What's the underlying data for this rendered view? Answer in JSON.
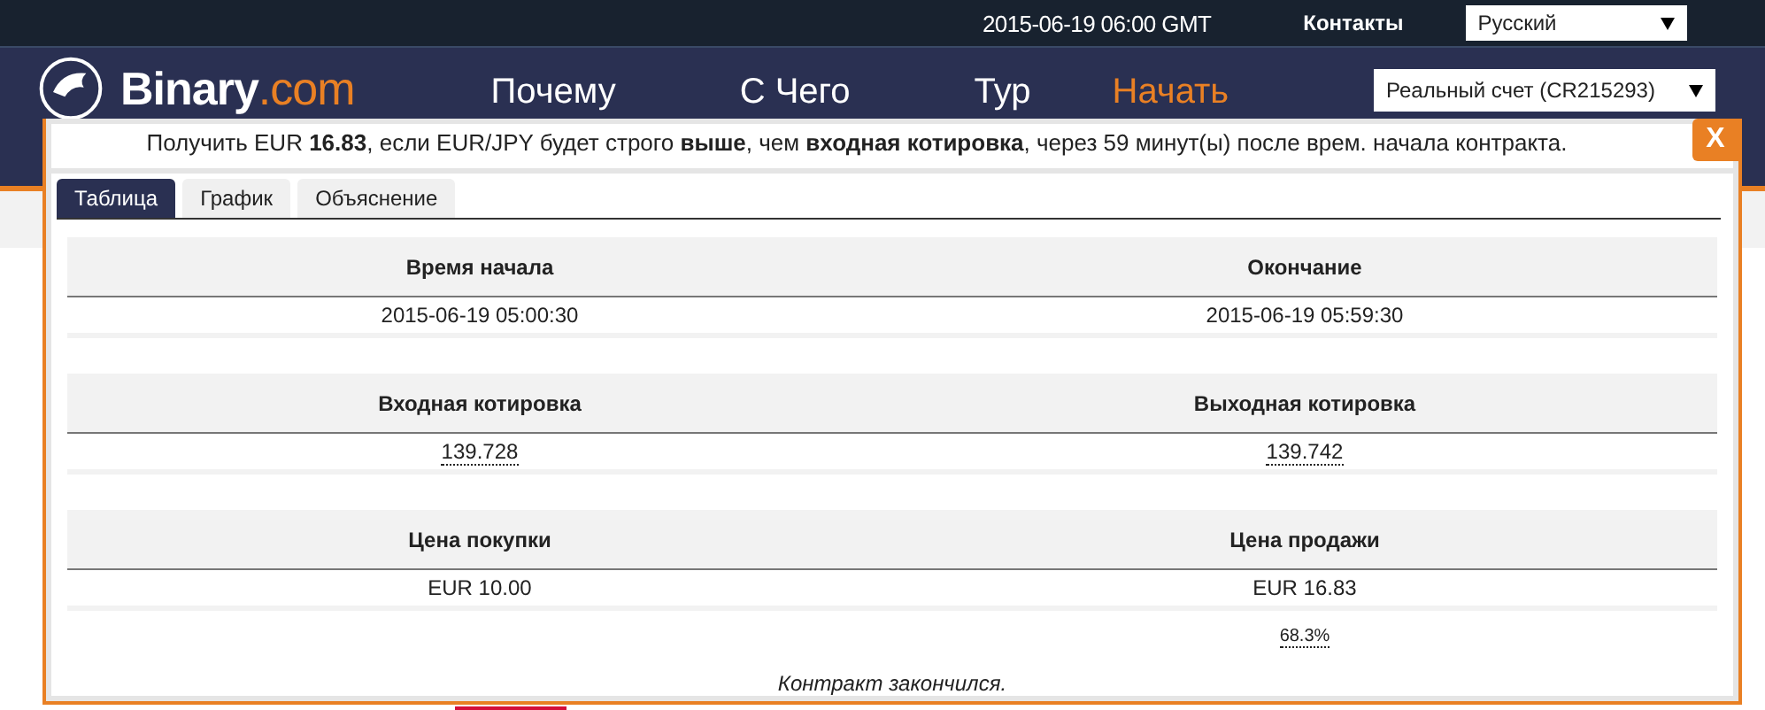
{
  "top_bar": {
    "time": "2015-06-19 06:00 GMT",
    "contacts": "Контакты",
    "language": "Русский"
  },
  "header": {
    "logo_name": "Binary",
    "logo_domain": ".com",
    "account": "Реальный счет (CR215293)",
    "nav": [
      {
        "label": "Почему",
        "highlight": false
      },
      {
        "label": "С Чего",
        "highlight": false
      },
      {
        "label": "Тур",
        "highlight": false
      },
      {
        "label": "Начать",
        "highlight": true
      }
    ]
  },
  "dialog": {
    "summary": "Получить EUR **16.83**, если EUR/JPY будет строго **выше**, чем **входная котировка**, через 59 минут(ы) после врем. начала контракта.",
    "close": "X",
    "tabs": [
      {
        "label": "Таблица",
        "selected": true
      },
      {
        "label": "График",
        "selected": false
      },
      {
        "label": "Объяснение",
        "selected": false
      }
    ],
    "sections": [
      {
        "columns": [
          {
            "heading": "Время начала",
            "value": "2015-06-19 05:00:30",
            "dotted": false
          },
          {
            "heading": "Окончание",
            "value": "2015-06-19 05:59:30",
            "dotted": false
          }
        ]
      },
      {
        "columns": [
          {
            "heading": "Входная котировка",
            "value": "139.728",
            "dotted": true
          },
          {
            "heading": "Выходная котировка",
            "value": "139.742",
            "dotted": true
          }
        ]
      },
      {
        "columns": [
          {
            "heading": "Цена покупки",
            "value": "EUR 10.00",
            "dotted": false
          },
          {
            "heading": "Цена продажи",
            "value": "EUR 16.83",
            "dotted": false
          }
        ]
      }
    ],
    "profit": "68.3%",
    "status": "Контракт закончился."
  }
}
